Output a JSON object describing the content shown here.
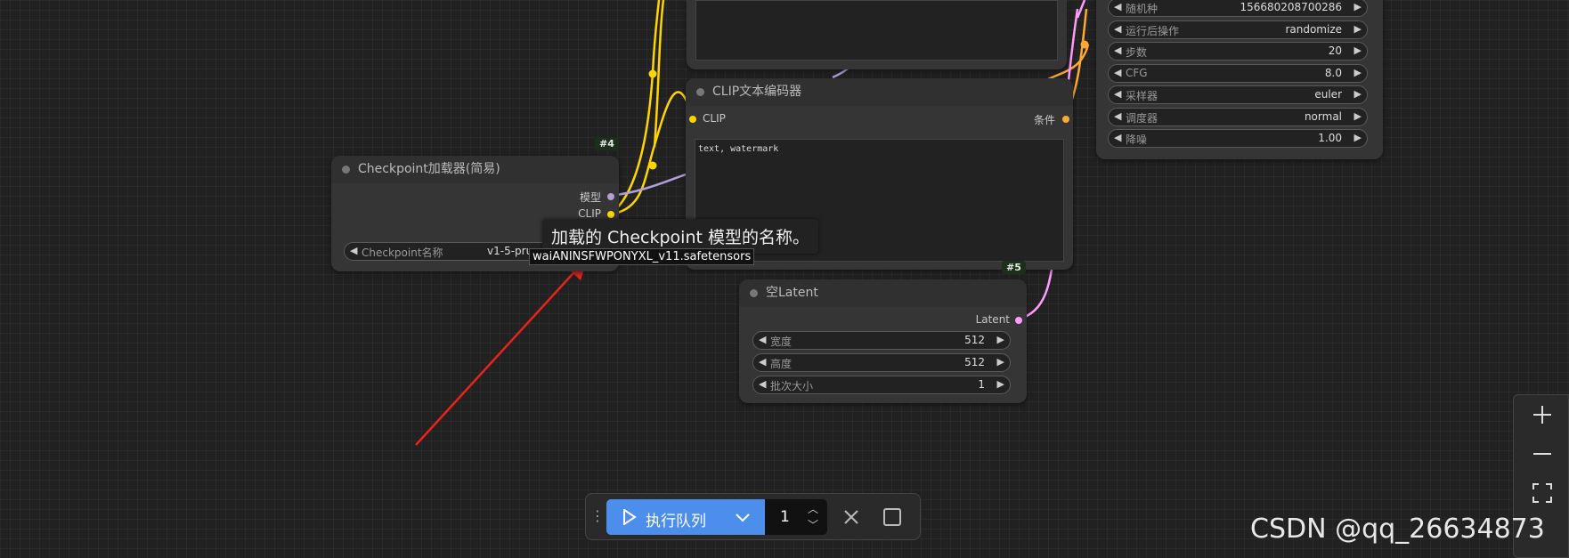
{
  "nodes": {
    "checkpoint": {
      "id": "#4",
      "title": "Checkpoint加载器(简易)",
      "outputs": [
        "模型",
        "CLIP"
      ],
      "widget": {
        "label": "Checkpoint名称",
        "value": "v1-5-pruned-ema"
      }
    },
    "clip_encoder": {
      "title": "CLIP文本编码器",
      "input": "CLIP",
      "output": "条件",
      "text": "text, watermark"
    },
    "empty_latent": {
      "id": "#5",
      "title": "空Latent",
      "output": "Latent",
      "widgets": [
        {
          "label": "宽度",
          "value": "512"
        },
        {
          "label": "高度",
          "value": "512"
        },
        {
          "label": "批次大小",
          "value": "1"
        }
      ]
    },
    "sampler": {
      "widgets": [
        {
          "label": "随机种",
          "value": "156680208700286"
        },
        {
          "label": "运行后操作",
          "value": "randomize"
        },
        {
          "label": "步数",
          "value": "20"
        },
        {
          "label": "CFG",
          "value": "8.0"
        },
        {
          "label": "采样器",
          "value": "euler"
        },
        {
          "label": "调度器",
          "value": "normal"
        },
        {
          "label": "降噪",
          "value": "1.00"
        }
      ]
    }
  },
  "tooltip": "加载的 Checkpoint 模型的名称。",
  "filename_popup": "waiANINSFWPONYXL_v11.safetensors",
  "queue": {
    "run_label": "执行队列",
    "count": "1"
  },
  "zoom_controls": [
    "zoom-in",
    "zoom-out",
    "fit-view"
  ],
  "watermark": "CSDN @qq_26634873",
  "colors": {
    "clip": "#ffd500",
    "model": "#b39ddb",
    "conditioning": "#ffa931",
    "latent": "#ff9cf9",
    "run_button": "#4c8eeb",
    "annotation": "#e8231b"
  }
}
